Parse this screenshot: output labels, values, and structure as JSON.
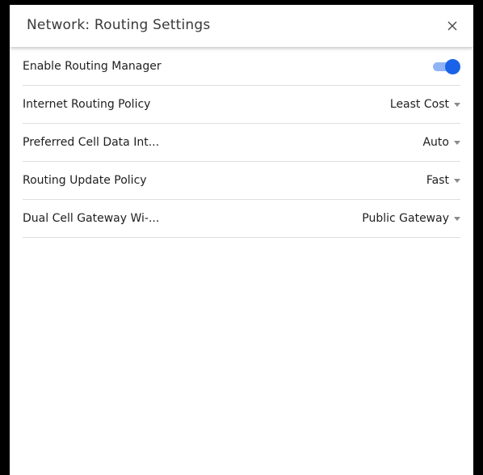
{
  "dialog": {
    "title": "Network: Routing Settings",
    "close_icon": "close-icon"
  },
  "settings": {
    "enable_routing_manager": {
      "label": "Enable Routing Manager",
      "enabled": true,
      "accent_color": "#1a63e8"
    },
    "internet_routing_policy": {
      "label": "Internet Routing Policy",
      "value": "Least Cost"
    },
    "preferred_cell_data_interface": {
      "label": "Preferred Cell Data Int...",
      "value": "Auto"
    },
    "routing_update_policy": {
      "label": "Routing Update Policy",
      "value": "Fast"
    },
    "dual_cell_gateway": {
      "label": "Dual Cell Gateway Wi-...",
      "value": "Public Gateway"
    }
  }
}
